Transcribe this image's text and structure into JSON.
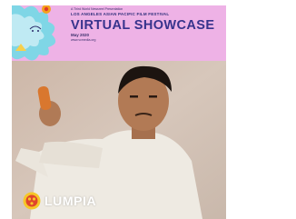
{
  "banner": {
    "presenter_line": "A Third World Newsreel Presentation",
    "festival_name": "LOS ANGELES ASIAN PACIFIC FILM FESTIVAL",
    "title": "VIRTUAL SHOWCASE",
    "date": "May 2020",
    "url": "www.vcmedia.org",
    "background_color": "#eeb2e6",
    "title_color": "#37338c"
  },
  "logo": {
    "text": "LUMPIA",
    "icon": "lumpia-logo-icon"
  }
}
